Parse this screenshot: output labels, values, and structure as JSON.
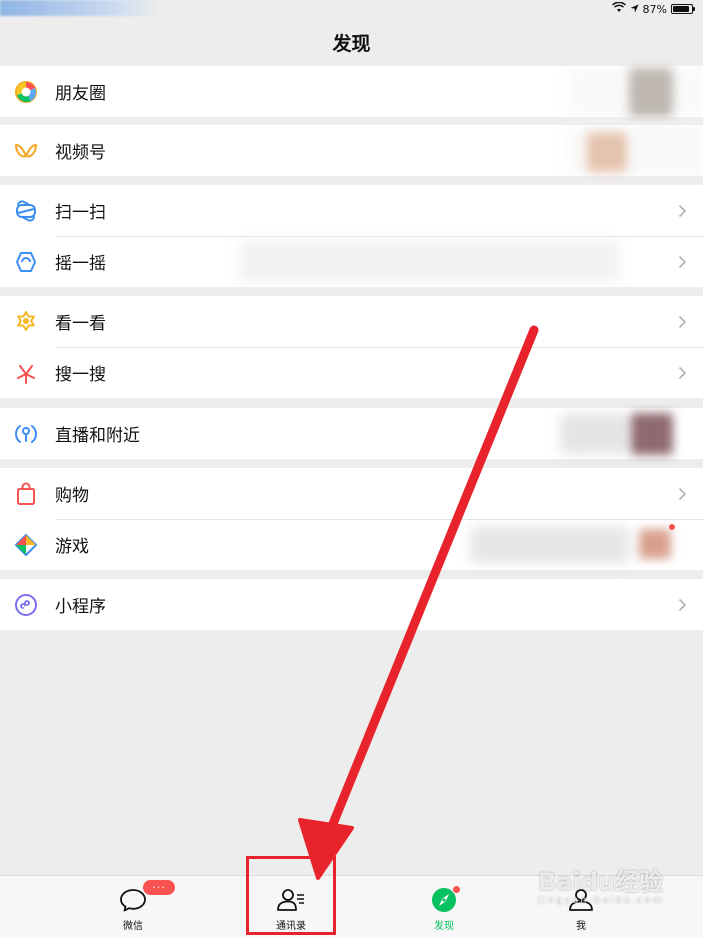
{
  "status_bar": {
    "battery_text": "87%",
    "battery_level": 0.87
  },
  "header": {
    "title": "发现"
  },
  "groups": [
    {
      "items": [
        {
          "label": "朋友圈",
          "icon": "moments-icon"
        }
      ]
    },
    {
      "items": [
        {
          "label": "视频号",
          "icon": "channels-icon"
        }
      ]
    },
    {
      "items": [
        {
          "label": "扫一扫",
          "icon": "scan-icon"
        },
        {
          "label": "摇一摇",
          "icon": "shake-icon"
        }
      ]
    },
    {
      "items": [
        {
          "label": "看一看",
          "icon": "top-stories-icon"
        },
        {
          "label": "搜一搜",
          "icon": "search-icon"
        }
      ]
    },
    {
      "items": [
        {
          "label": "直播和附近",
          "icon": "live-nearby-icon"
        }
      ]
    },
    {
      "items": [
        {
          "label": "购物",
          "icon": "shopping-bag-icon"
        },
        {
          "label": "游戏",
          "icon": "games-icon"
        }
      ]
    },
    {
      "items": [
        {
          "label": "小程序",
          "icon": "mini-programs-icon"
        }
      ]
    }
  ],
  "tabbar": {
    "tabs": [
      {
        "label": "微信",
        "icon": "chat-bubble-icon",
        "badge": "···"
      },
      {
        "label": "通讯录",
        "icon": "contacts-icon"
      },
      {
        "label": "发现",
        "icon": "discover-compass-icon",
        "active": true
      },
      {
        "label": "我",
        "icon": "me-person-icon"
      }
    ]
  },
  "watermark": {
    "text": "Baidu经验",
    "sub": "jingyan.baidu.com"
  },
  "colors": {
    "accent_green": "#07c160",
    "badge_red": "#fa5151",
    "annotation_red": "#e8232b",
    "background": "#ededed"
  }
}
